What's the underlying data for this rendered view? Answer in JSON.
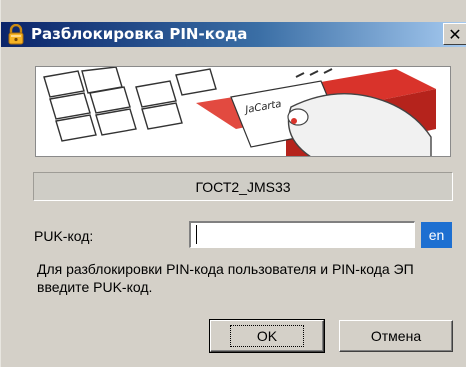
{
  "window": {
    "title": "Разблокировка PIN-кода",
    "close_glyph": "✕",
    "title_icon": "padlock-icon"
  },
  "banner": {
    "card_brand": "JaCarta"
  },
  "token": {
    "name": "ГОСТ2_JMS33"
  },
  "form": {
    "puk_label": "PUK-код:",
    "puk_value": "",
    "lang": "en"
  },
  "hint": {
    "text": "Для разблокировки PIN-кода пользователя и PIN-кода ЭП введите PUK-код."
  },
  "buttons": {
    "ok_label": "OK",
    "cancel_label": "Отмена"
  },
  "colors": {
    "title_start": "#0a246a",
    "title_end": "#a6caf0",
    "lang_badge": "#1d6fd1",
    "card_red": "#d9332b"
  }
}
